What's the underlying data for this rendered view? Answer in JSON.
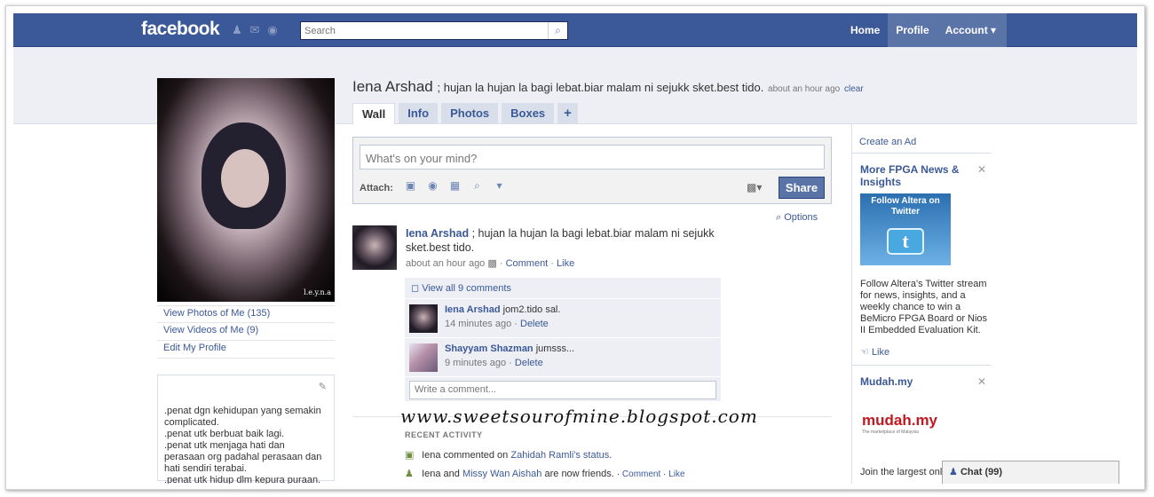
{
  "topbar": {
    "logo": "facebook",
    "search_placeholder": "Search",
    "nav": [
      "Home",
      "Profile",
      "Account ▾"
    ]
  },
  "profile": {
    "name": "Iena Arshad",
    "status": "; hujan la hujan la bagi lebat.biar malam ni sejukk sket.best tido.",
    "status_time": "about an hour ago",
    "clear": "clear",
    "photo_signature": "l.e.y.n.a",
    "tabs": [
      "Wall",
      "Info",
      "Photos",
      "Boxes",
      "+"
    ],
    "links": [
      "View Photos of Me (135)",
      "View Videos of Me (9)",
      "Edit My Profile"
    ],
    "bio": ".penat dgn kehidupan yang semakin complicated.\n.penat utk berbuat baik lagi.\n.penat utk menjaga hati dan perasaan org padahal perasaan dan hati sendiri terabai.\n.penat utk hidup dlm kepura puraan."
  },
  "composer": {
    "placeholder": "What's on your mind?",
    "attach_label": "Attach:",
    "share_label": "Share",
    "options_label": "Options"
  },
  "story": {
    "name": "Iena Arshad",
    "text": "; hujan la hujan la bagi lebat.biar malam ni sejukk sket.best tido.",
    "time": "about an hour ago",
    "comment_link": "Comment",
    "like_link": "Like",
    "view_all": "View all 9 comments",
    "comments": [
      {
        "name": "Iena Arshad",
        "text": "jom2.tido sal.",
        "time": "14 minutes ago",
        "delete": "Delete"
      },
      {
        "name": "Shayyam Shazman",
        "text": "jumsss...",
        "time": "9 minutes ago",
        "delete": "Delete"
      }
    ],
    "write_placeholder": "Write a comment..."
  },
  "watermark": "www.sweetsourofmine.blogspot.com",
  "recent": {
    "heading": "RECENT ACTIVITY",
    "item1_prefix": "Iena commented on",
    "item1_link": "Zahidah Ramli's status",
    "item2_prefix": "Iena and",
    "item2_link": "Missy Wan Aishah",
    "item2_suffix": "are now friends.",
    "item2_comment": "Comment",
    "item2_like": "Like"
  },
  "ads": {
    "create_ad": "Create an Ad",
    "ad1_title": "More FPGA News & Insights",
    "ad1_image_text": "Follow Altera on Twitter",
    "ad1_image_icon": "t",
    "ad1_body": "Follow Altera's Twitter stream for news, insights, and a weekly chance to win a BeMicro FPGA Board or Nios II Embedded Evaluation Kit.",
    "ad1_like": "Like",
    "ad2_title": "Mudah.my",
    "ad2_logo": "mudah.my",
    "ad2_logo_tag": "The marketplace of Malaysia",
    "ad2_body": "Join the largest onli"
  },
  "chat": {
    "label": "Chat (99)"
  },
  "colors": {
    "brand_blue": "#3b5998",
    "link": "#3b5998",
    "background": "#ffffff"
  }
}
